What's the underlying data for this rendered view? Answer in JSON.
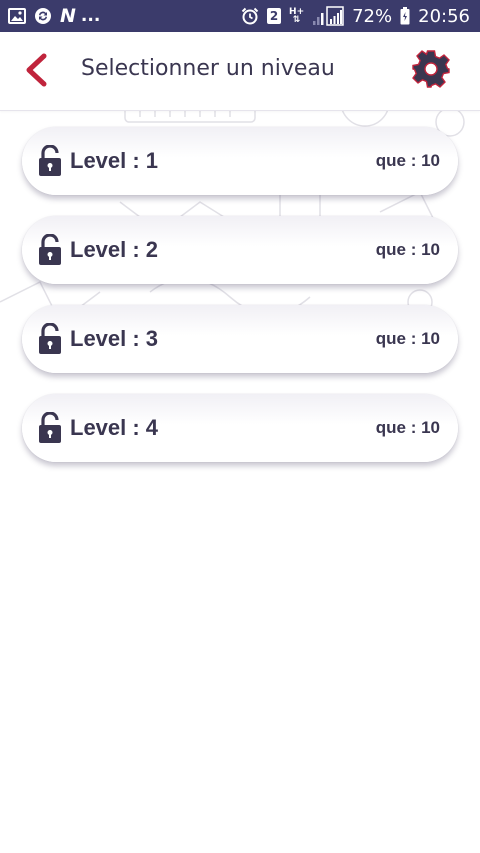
{
  "status_bar": {
    "left_icons": [
      "image-icon",
      "sync-icon",
      "netflix-n-icon"
    ],
    "brand_letter": "N",
    "more_indicator": "...",
    "sim_label": "2",
    "network_type": "H+",
    "battery_percent": "72%",
    "time": "20:56"
  },
  "header": {
    "title": "Selectionner un niveau",
    "back_icon": "chevron-left-icon",
    "settings_icon": "gear-icon"
  },
  "colors": {
    "status_bar_bg": "#3b3b6b",
    "accent_red": "#c0243c",
    "text_dark": "#3a3650"
  },
  "levels": [
    {
      "label": "Level : 1",
      "questions": "que : 10",
      "icon": "unlock-icon"
    },
    {
      "label": "Level : 2",
      "questions": "que : 10",
      "icon": "unlock-icon"
    },
    {
      "label": "Level : 3",
      "questions": "que : 10",
      "icon": "unlock-icon"
    },
    {
      "label": "Level : 4",
      "questions": "que : 10",
      "icon": "unlock-icon"
    }
  ]
}
